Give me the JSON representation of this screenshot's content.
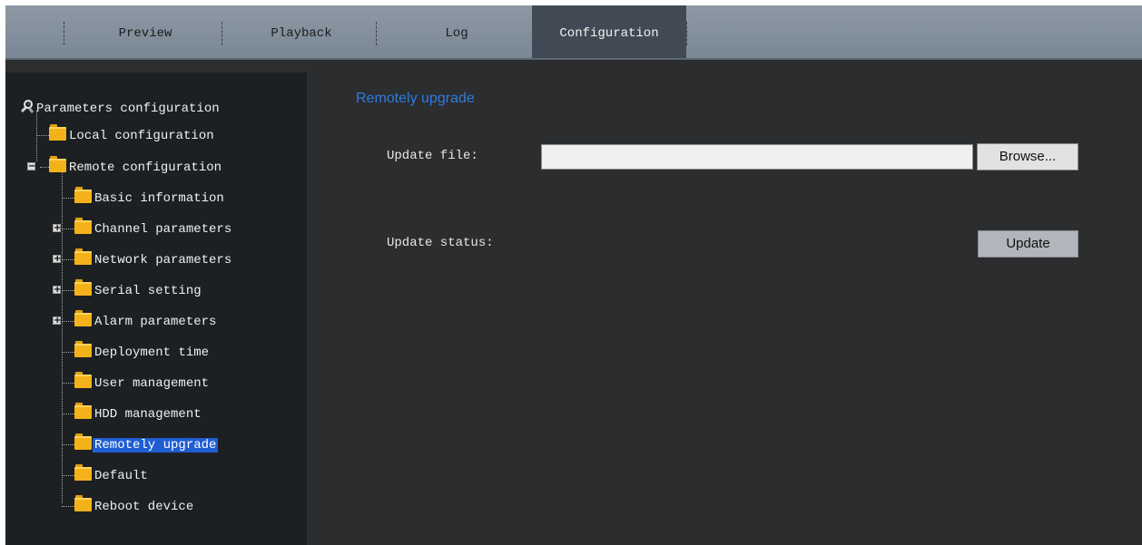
{
  "tabs": [
    {
      "label": "Preview",
      "active": false
    },
    {
      "label": "Playback",
      "active": false
    },
    {
      "label": "Log",
      "active": false
    },
    {
      "label": "Configuration",
      "active": true
    }
  ],
  "tree": {
    "root": "Parameters configuration",
    "local": "Local configuration",
    "remote": "Remote configuration",
    "children": [
      {
        "label": "Basic information",
        "expandable": false
      },
      {
        "label": "Channel parameters",
        "expandable": true
      },
      {
        "label": "Network parameters",
        "expandable": true
      },
      {
        "label": "Serial setting",
        "expandable": true
      },
      {
        "label": "Alarm parameters",
        "expandable": true
      },
      {
        "label": "Deployment time",
        "expandable": false
      },
      {
        "label": "User management",
        "expandable": false
      },
      {
        "label": "HDD management",
        "expandable": false
      },
      {
        "label": "Remotely upgrade",
        "expandable": false,
        "selected": true
      },
      {
        "label": "Default",
        "expandable": false
      },
      {
        "label": "Reboot device",
        "expandable": false
      }
    ]
  },
  "main": {
    "title": "Remotely upgrade",
    "update_file_label": "Update file:",
    "update_file_value": "",
    "browse_label": "Browse...",
    "update_status_label": "Update status:",
    "update_label": "Update"
  },
  "colors": {
    "accent": "#2f7be0",
    "selection": "#1f5ed2",
    "folder": "#f4b21a"
  }
}
